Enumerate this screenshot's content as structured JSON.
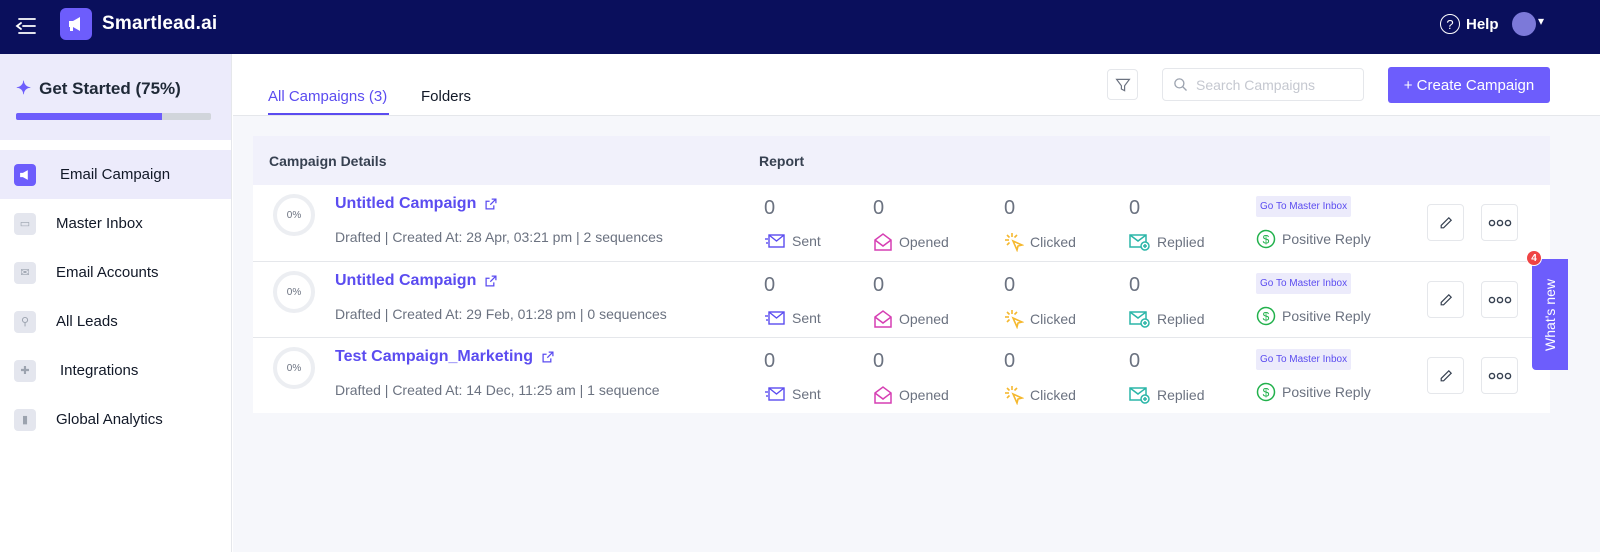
{
  "app": {
    "name": "Smartlead.ai"
  },
  "topbar": {
    "help_label": "Help"
  },
  "sidebar": {
    "get_started": {
      "label": "Get Started (75%)",
      "progress_percent": 75
    },
    "items": [
      {
        "label": "Email Campaign",
        "icon": "megaphone-icon",
        "active": true
      },
      {
        "label": "Master Inbox",
        "icon": "inbox-icon"
      },
      {
        "label": "Email Accounts",
        "icon": "envelope-icon"
      },
      {
        "label": "All Leads",
        "icon": "lead-icon"
      },
      {
        "label": "Integrations",
        "icon": "puzzle-icon"
      },
      {
        "label": "Global Analytics",
        "icon": "analytics-icon"
      }
    ]
  },
  "tabs": [
    {
      "label": "All Campaigns (3)",
      "active": true
    },
    {
      "label": "Folders"
    }
  ],
  "search": {
    "placeholder": "Search Campaigns",
    "value": ""
  },
  "create_button": "+ Create Campaign",
  "table": {
    "headers": {
      "details": "Campaign Details",
      "report": "Report"
    },
    "stat_labels": {
      "sent": "Sent",
      "opened": "Opened",
      "clicked": "Clicked",
      "replied": "Replied",
      "positive": "Positive Reply"
    },
    "go_to_master": "Go To Master Inbox",
    "rows": [
      {
        "progress": "0%",
        "name": "Untitled Campaign",
        "meta": "Drafted | Created At: 28 Apr, 03:21 pm | 2 sequences",
        "sent": "0",
        "opened": "0",
        "clicked": "0",
        "replied": "0"
      },
      {
        "progress": "0%",
        "name": "Untitled Campaign",
        "meta": "Drafted | Created At: 29 Feb, 01:28 pm | 0 sequences",
        "sent": "0",
        "opened": "0",
        "clicked": "0",
        "replied": "0"
      },
      {
        "progress": "0%",
        "name": "Test Campaign_Marketing",
        "meta": "Drafted | Created At: 14 Dec, 11:25 am | 1 sequence",
        "sent": "0",
        "opened": "0",
        "clicked": "0",
        "replied": "0"
      }
    ]
  },
  "whats_new": {
    "label": "What's new",
    "badge": "4"
  },
  "colors": {
    "primary": "#6d5dfc",
    "topbar": "#0a0f5c",
    "accent_text": "#5b4cf0",
    "opened": "#d63fb3",
    "clicked": "#f5b82e",
    "replied": "#2bb6a8",
    "positive": "#22b14c"
  }
}
